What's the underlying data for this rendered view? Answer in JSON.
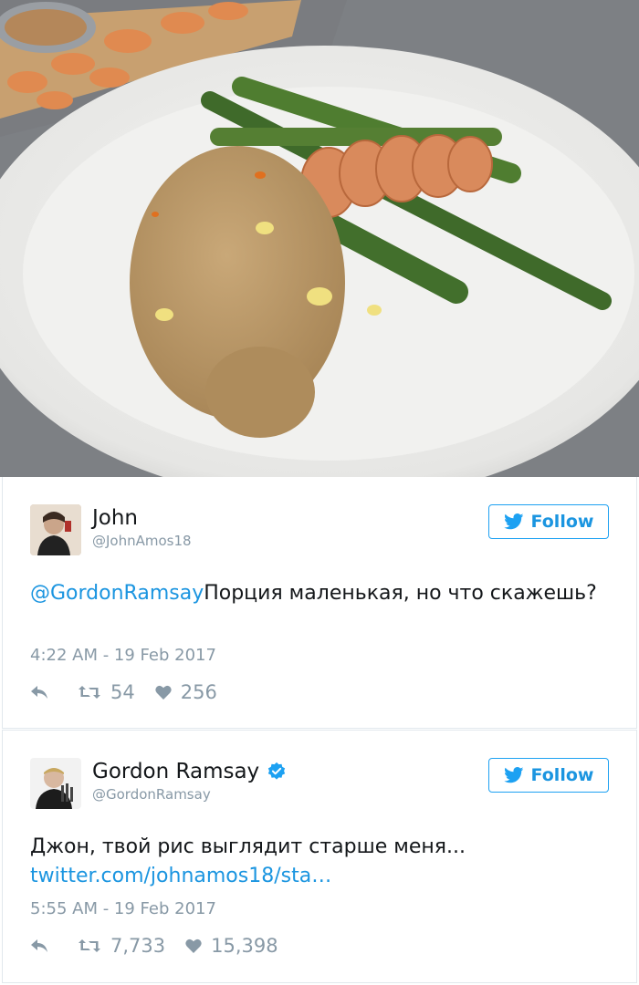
{
  "tweets": [
    {
      "name": "John",
      "handle": "@JohnAmos18",
      "follow_label": "Follow",
      "mention": "@GordonRamsay",
      "text": "Порция маленькая, но что скажешь?",
      "timestamp": "4:22 AM - 19 Feb 2017",
      "retweets": "54",
      "likes": "256"
    },
    {
      "name": "Gordon Ramsay",
      "handle": "@GordonRamsay",
      "follow_label": "Follow",
      "text": "Джон, твой рис выглядит старше меня...",
      "link": "twitter.com/johnamos18/sta…",
      "timestamp": "5:55 AM - 19 Feb 2017",
      "retweets": "7,733",
      "likes": "15,398"
    }
  ],
  "icons": {
    "reply": "reply-icon",
    "retweet": "retweet-icon",
    "like": "heart-icon",
    "follow": "twitter-bird-icon",
    "verified": "verified-badge-icon"
  },
  "colors": {
    "link": "#1b95e0",
    "muted": "#8899a6",
    "border": "#e1e8ed"
  }
}
